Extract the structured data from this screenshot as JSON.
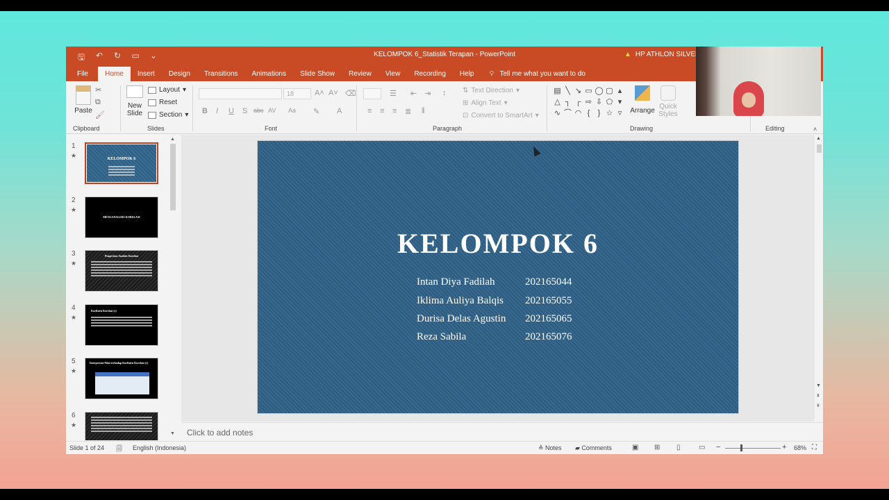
{
  "window": {
    "title": "KELOMPOK 6_Statistik Terapan  -  PowerPoint",
    "account": "HP ATHLON SILVER"
  },
  "tabs": [
    "File",
    "Home",
    "Insert",
    "Design",
    "Transitions",
    "Animations",
    "Slide Show",
    "Review",
    "View",
    "Recording",
    "Help"
  ],
  "tell_me": "Tell me what you want to do",
  "ribbon": {
    "clipboard": {
      "paste": "Paste",
      "label": "Clipboard"
    },
    "slides": {
      "new_slide_line1": "New",
      "new_slide_line2": "Slide",
      "layout": "Layout",
      "reset": "Reset",
      "section": "Section",
      "label": "Slides"
    },
    "font": {
      "label": "Font",
      "size": "18"
    },
    "paragraph": {
      "text_direction": "Text Direction",
      "align_text": "Align Text",
      "convert_smartart": "Convert to SmartArt",
      "label": "Paragraph"
    },
    "drawing": {
      "arrange": "Arrange",
      "quick_styles_line1": "Quick",
      "quick_styles_line2": "Styles",
      "label": "Drawing"
    },
    "editing": {
      "label": "Editing"
    }
  },
  "thumbnails": [
    {
      "num": "1",
      "title": "KELOMPOK 6"
    },
    {
      "num": "2",
      "title": "MENGANALISIS KORELASI"
    },
    {
      "num": "3",
      "title": "Pengertian Analisis Korelasi"
    },
    {
      "num": "4",
      "title": "Koefisien Korelasi (r)"
    },
    {
      "num": "5",
      "title": "Interpretasi Nilai terhadap Koefisien Korelasi (r)"
    },
    {
      "num": "6",
      "title": ""
    }
  ],
  "slide": {
    "title": "KELOMPOK 6",
    "members": [
      {
        "name": "Intan Diya Fadilah",
        "nim": "202165044"
      },
      {
        "name": "Iklima Auliya Balqis",
        "nim": "202165055"
      },
      {
        "name": "Durisa Delas Agustin",
        "nim": "202165065"
      },
      {
        "name": "Reza Sabila",
        "nim": "202165076"
      }
    ]
  },
  "notes": {
    "placeholder": "Click to add notes"
  },
  "status": {
    "slide_info": "Slide 1 of 24",
    "language": "English (Indonesia)",
    "notes": "Notes",
    "comments": "Comments",
    "zoom": "68%",
    "zoom_fraction": 0.68
  },
  "colors": {
    "accent": "#c84b25",
    "slide_bg": "#2f5f83"
  }
}
